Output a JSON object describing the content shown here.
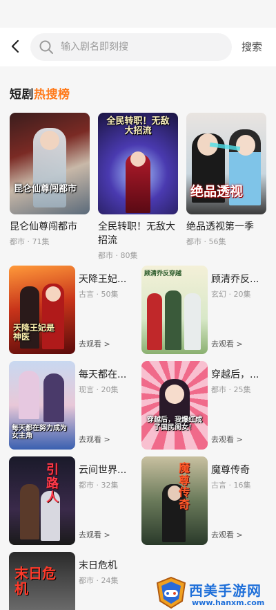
{
  "search": {
    "placeholder": "输入剧名即刻搜",
    "button_label": "搜索"
  },
  "section": {
    "title_part1": "短剧",
    "title_part2": "热搜榜"
  },
  "hot_list": [
    {
      "name": "昆仑仙尊闯都市",
      "meta": "都市 · 71集",
      "cover_text": "昆仑仙尊闯都市"
    },
    {
      "name": "全民转职！无敌大招流",
      "meta": "都市 · 80集",
      "cover_text": "全民转职！无敌大招流"
    },
    {
      "name": "绝品透视第一季",
      "meta": "都市 · 56集",
      "cover_text": "绝品透视"
    }
  ],
  "drama_list": [
    {
      "title": "天降王妃...",
      "meta": "古言 · 50集",
      "go": "去观看 >",
      "cover_text": "天降王妃是神医"
    },
    {
      "title": "顾清乔反...",
      "meta": "玄幻 · 20集",
      "go": "去观看 >",
      "cover_text": "顾清乔反穿越"
    },
    {
      "title": "每天都在...",
      "meta": "现言 · 20集",
      "go": "去观看 >",
      "cover_text": "每天都在努力成为女主角"
    },
    {
      "title": "穿越后，...",
      "meta": "都市 · 25集",
      "go": "去观看 >",
      "cover_text": "穿越后，我爆红成了国民闺女！"
    },
    {
      "title": "云间世界...",
      "meta": "都市 · 32集",
      "go": "去观看 >",
      "cover_text": "引路人"
    },
    {
      "title": "魔尊传奇",
      "meta": "古言 · 16集",
      "go": "去观看 >",
      "cover_text": "魔尊传奇"
    },
    {
      "title": "末日危机",
      "meta": "都市 · 24集",
      "go": "",
      "cover_text": "末日危机"
    }
  ],
  "watermark": {
    "title": "西美手游网",
    "url": "www.hanxm.com"
  },
  "colors": {
    "accent": "#ff7a1a",
    "watermark": "#1e6fd9"
  }
}
